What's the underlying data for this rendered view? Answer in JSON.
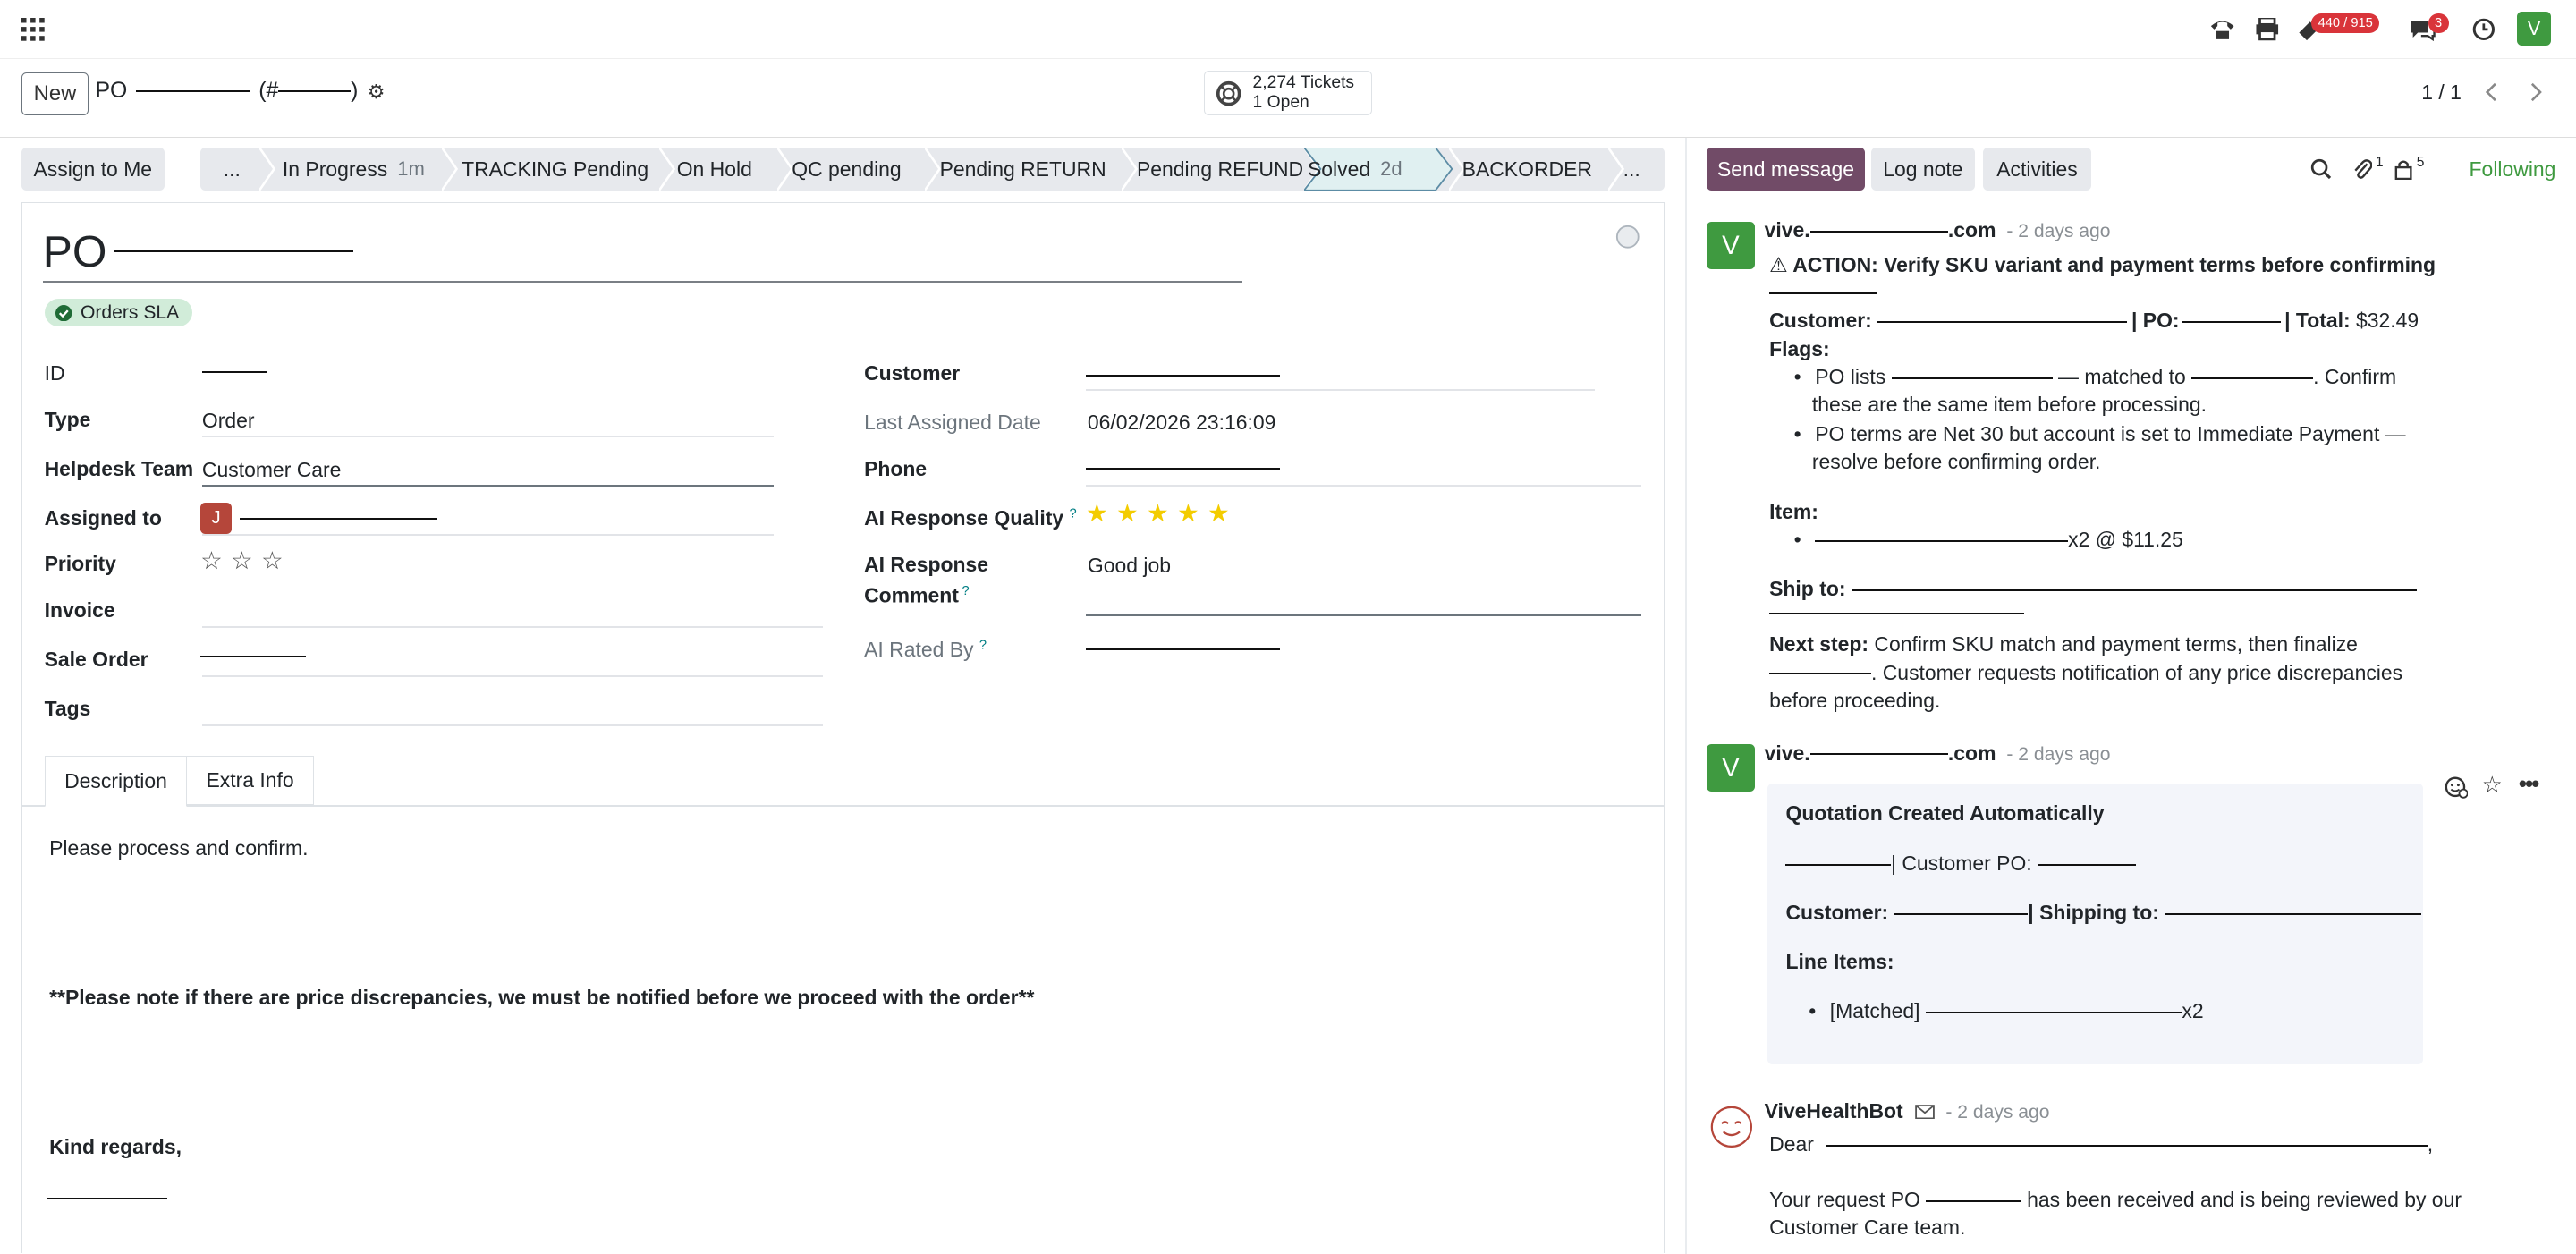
{
  "topbar": {
    "activity_count": "440 / 915",
    "chat_count": "3",
    "user_initial": "V"
  },
  "control": {
    "new_label": "New",
    "breadcrumb_prefix": "PO",
    "breadcrumb_open": "(#",
    "breadcrumb_close": ")",
    "tickets_count": "2,274 Tickets",
    "tickets_open": "1 Open",
    "pager": "1 / 1"
  },
  "actions": {
    "assign_label": "Assign to Me",
    "stages": [
      {
        "label": "...",
        "duration": ""
      },
      {
        "label": "In Progress",
        "duration": "1m"
      },
      {
        "label": "TRACKING Pending",
        "duration": ""
      },
      {
        "label": "On Hold",
        "duration": ""
      },
      {
        "label": "QC pending",
        "duration": ""
      },
      {
        "label": "Pending RETURN",
        "duration": ""
      },
      {
        "label": "Pending REFUND",
        "duration": ""
      },
      {
        "label": "Solved",
        "duration": "2d"
      },
      {
        "label": "BACKORDER",
        "duration": ""
      },
      {
        "label": "...",
        "duration": ""
      }
    ],
    "active_stage": "Solved"
  },
  "form": {
    "title_prefix": "PO",
    "sla_badge": "Orders SLA",
    "left_fields": {
      "id_label": "ID",
      "type_label": "Type",
      "type_value": "Order",
      "team_label": "Helpdesk Team",
      "team_value": "Customer Care",
      "assigned_label": "Assigned to",
      "assigned_initial": "J",
      "priority_label": "Priority",
      "invoice_label": "Invoice",
      "sale_order_label": "Sale Order",
      "tags_label": "Tags"
    },
    "right_fields": {
      "customer_label": "Customer",
      "last_assigned_label": "Last Assigned Date",
      "last_assigned_value": "06/02/2026 23:16:09",
      "phone_label": "Phone",
      "ai_quality_label": "AI Response Quality",
      "ai_quality_stars": 5,
      "ai_comment_label": "AI Response",
      "ai_comment_label2": "Comment",
      "ai_comment_value": "Good job",
      "ai_rated_label": "AI Rated By",
      "tooltip_mark": "?"
    },
    "tabs": [
      "Description",
      "Extra Info"
    ],
    "description": {
      "line1": "Please process and confirm.",
      "line2": "**Please note if there are price discrepancies, we must be notified before we proceed with the order**",
      "line3": "Kind regards,"
    }
  },
  "chatter": {
    "send_label": "Send message",
    "log_label": "Log note",
    "activities_label": "Activities",
    "attachments_count": "1",
    "followers_count": "5",
    "following_label": "Following",
    "messages": [
      {
        "author_prefix": "vive.",
        "author_suffix": ".com",
        "date": "- 2 days ago",
        "action": "⚠ ACTION: Verify SKU variant and payment terms before confirming",
        "customer_label": "Customer:",
        "po_label": "| PO:",
        "total_label": "| Total:",
        "total_value": "$32.49",
        "flags_label": "Flags:",
        "flag1_a": "PO lists",
        "flag1_b": "— matched to",
        "flag1_c": ". Confirm",
        "flag1_d": "these are the same item before processing.",
        "flag2_a": "PO terms are Net 30 but account is set to Immediate Payment —",
        "flag2_b": "resolve before confirming order.",
        "item_label": "Item:",
        "item_qty": "x2 @ $11.25",
        "ship_label": "Ship to:",
        "next_label": "Next step:",
        "next_a": "Confirm SKU match and payment terms, then finalize",
        "next_b": ". Customer requests notification of any price discrepancies",
        "next_c": "before proceeding."
      },
      {
        "author_prefix": "vive.",
        "author_suffix": ".com",
        "date": "- 2 days ago",
        "quote_title": "Quotation Created Automatically",
        "customer_po_label": "| Customer PO:",
        "customer_label": "Customer:",
        "shipping_label": "| Shipping to:",
        "line_items_label": "Line Items:",
        "line_item_prefix": "[Matched]",
        "line_item_qty": "x2"
      },
      {
        "author": "ViveHealthBot",
        "date": "- 2 days ago",
        "dear": "Dear",
        "body_a": "Your request PO",
        "body_b": "has been received and is being reviewed by our",
        "body_c": "Customer Care team."
      }
    ]
  },
  "colors": {
    "primary": "#714b67",
    "success": "#3f9a40",
    "badge_green_bg": "#d1ecd9",
    "danger": "#d9343a",
    "star": "#f3cc00"
  }
}
